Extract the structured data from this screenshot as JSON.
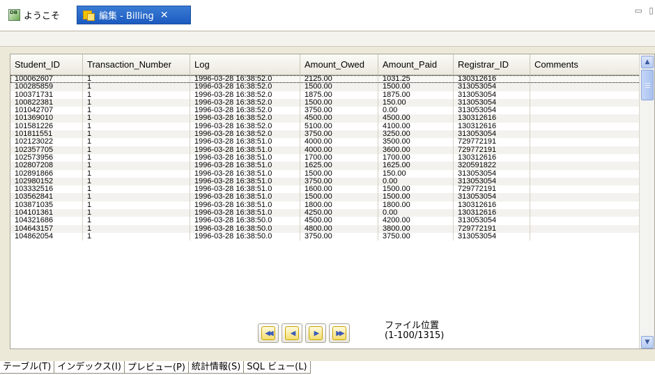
{
  "tabs": {
    "welcome_label": "ようこそ",
    "welcome_icon": "database-logo-icon",
    "billing_label": "編集 - Billing",
    "billing_icon": "edit-table-icon",
    "close_glyph": "✕",
    "accent_color": "#2b6acb"
  },
  "grid": {
    "columns": [
      "Student_ID",
      "Transaction_Number",
      "Log",
      "Amount_Owed",
      "Amount_Paid",
      "Registrar_ID",
      "Comments"
    ],
    "rows": [
      [
        "100062607",
        "1",
        "1996-03-28 16:38:52.0",
        "2125.00",
        "1031.25",
        "130312616",
        ""
      ],
      [
        "100285859",
        "1",
        "1996-03-28 16:38:52.0",
        "1500.00",
        "1500.00",
        "313053054",
        ""
      ],
      [
        "100371731",
        "1",
        "1996-03-28 16:38:52.0",
        "1875.00",
        "1875.00",
        "313053054",
        ""
      ],
      [
        "100822381",
        "1",
        "1996-03-28 16:38:52.0",
        "1500.00",
        "150.00",
        "313053054",
        ""
      ],
      [
        "101042707",
        "1",
        "1996-03-28 16:38:52.0",
        "3750.00",
        "0.00",
        "313053054",
        ""
      ],
      [
        "101369010",
        "1",
        "1996-03-28 16:38:52.0",
        "4500.00",
        "4500.00",
        "130312616",
        ""
      ],
      [
        "101581226",
        "1",
        "1996-03-28 16:38:52.0",
        "5100.00",
        "4100.00",
        "130312616",
        ""
      ],
      [
        "101811551",
        "1",
        "1996-03-28 16:38:52.0",
        "3750.00",
        "3250.00",
        "313053054",
        ""
      ],
      [
        "102123022",
        "1",
        "1996-03-28 16:38:51.0",
        "4000.00",
        "3500.00",
        "729772191",
        ""
      ],
      [
        "102357705",
        "1",
        "1996-03-28 16:38:51.0",
        "4000.00",
        "3600.00",
        "729772191",
        ""
      ],
      [
        "102573956",
        "1",
        "1996-03-28 16:38:51.0",
        "1700.00",
        "1700.00",
        "130312616",
        ""
      ],
      [
        "102807208",
        "1",
        "1996-03-28 16:38:51.0",
        "1625.00",
        "1625.00",
        "320591822",
        ""
      ],
      [
        "102891866",
        "1",
        "1996-03-28 16:38:51.0",
        "1500.00",
        "150.00",
        "313053054",
        ""
      ],
      [
        "102980152",
        "1",
        "1996-03-28 16:38:51.0",
        "3750.00",
        "0.00",
        "313053054",
        ""
      ],
      [
        "103332516",
        "1",
        "1996-03-28 16:38:51.0",
        "1600.00",
        "1500.00",
        "729772191",
        ""
      ],
      [
        "103562841",
        "1",
        "1996-03-28 16:38:51.0",
        "1500.00",
        "1500.00",
        "313053054",
        ""
      ],
      [
        "103871035",
        "1",
        "1996-03-28 16:38:51.0",
        "1800.00",
        "1800.00",
        "130312616",
        ""
      ],
      [
        "104101361",
        "1",
        "1996-03-28 16:38:51.0",
        "4250.00",
        "0.00",
        "130312616",
        ""
      ],
      [
        "104321686",
        "1",
        "1996-03-28 16:38:50.0",
        "4500.00",
        "4200.00",
        "313053054",
        ""
      ],
      [
        "104643157",
        "1",
        "1996-03-28 16:38:50.0",
        "4800.00",
        "3800.00",
        "729772191",
        ""
      ],
      [
        "104862054",
        "1",
        "1996-03-28 16:38:50.0",
        "3750.00",
        "3750.00",
        "313053054",
        ""
      ]
    ]
  },
  "navigation": {
    "first_icon": "first-page-icon",
    "prev_icon": "prev-page-icon",
    "next_icon": "next-page-icon",
    "last_icon": "last-page-icon",
    "position_label": "ファイル位置",
    "position_value": "(1-100/1315)"
  },
  "bottom_tabs": [
    "テーブル(T)",
    "インデックス(I)",
    "プレビュー(P)",
    "統計情報(S)",
    "SQL ビュー(L)"
  ],
  "active_bottom_tab": 2
}
